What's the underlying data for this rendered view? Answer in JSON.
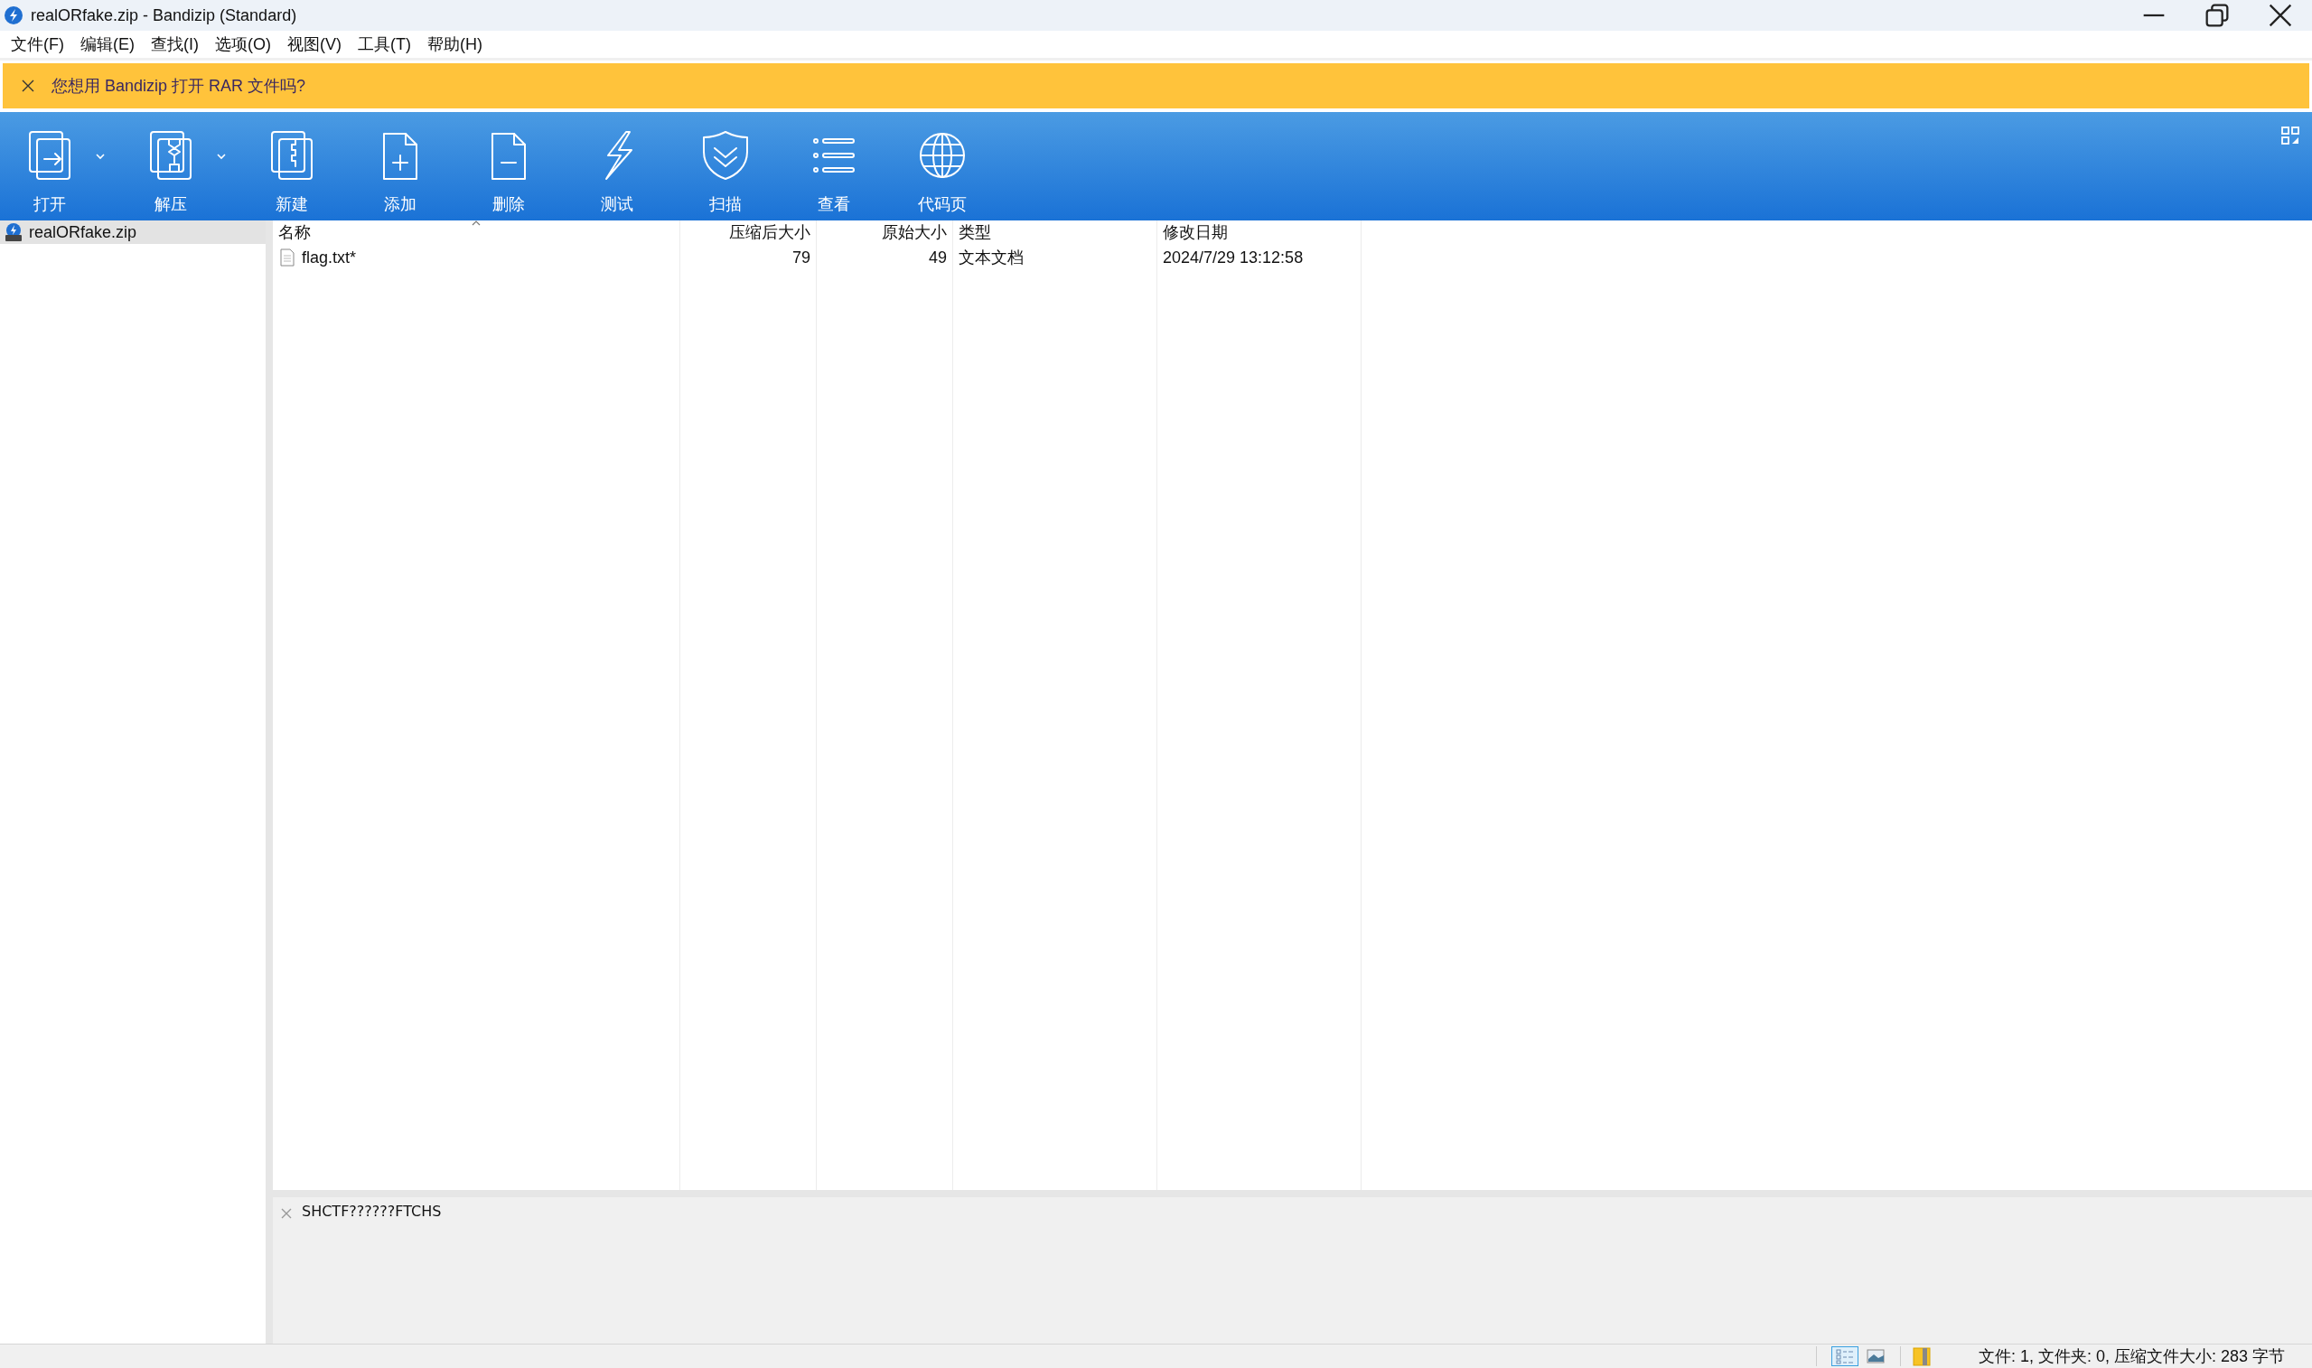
{
  "window": {
    "title": "realORfake.zip - Bandizip (Standard)"
  },
  "menu": [
    "文件(F)",
    "编辑(E)",
    "查找(I)",
    "选项(O)",
    "视图(V)",
    "工具(T)",
    "帮助(H)"
  ],
  "banner": {
    "text": "您想用 Bandizip 打开 RAR 文件吗?"
  },
  "toolbar": [
    {
      "kind": "open",
      "label": "打开",
      "dropdown": true
    },
    {
      "kind": "extract",
      "label": "解压",
      "dropdown": true
    },
    {
      "kind": "new",
      "label": "新建",
      "dropdown": false
    },
    {
      "kind": "add",
      "label": "添加",
      "dropdown": false
    },
    {
      "kind": "delete",
      "label": "删除",
      "dropdown": false
    },
    {
      "kind": "test",
      "label": "测试",
      "dropdown": false
    },
    {
      "kind": "scan",
      "label": "扫描",
      "dropdown": false
    },
    {
      "kind": "view",
      "label": "查看",
      "dropdown": false
    },
    {
      "kind": "codepage",
      "label": "代码页",
      "dropdown": false
    }
  ],
  "tree": [
    {
      "label": "realORfake.zip",
      "selected": true
    }
  ],
  "table": {
    "columns": [
      {
        "label": "名称",
        "kind": "text",
        "sorted": true
      },
      {
        "label": "压缩后大小",
        "kind": "number",
        "sorted": false
      },
      {
        "label": "原始大小",
        "kind": "number",
        "sorted": false
      },
      {
        "label": "类型",
        "kind": "text",
        "sorted": false
      },
      {
        "label": "修改日期",
        "kind": "text",
        "sorted": false
      }
    ],
    "rows": [
      {
        "cells": [
          "flag.txt*",
          "79",
          "49",
          "文本文档",
          "2024/7/29 13:12:58"
        ]
      }
    ]
  },
  "comment": {
    "text": "SHCTF??????FTCHS"
  },
  "status_bar": {
    "view_modes": [
      {
        "kind": "details",
        "selected": true
      },
      {
        "kind": "preview",
        "selected": false
      }
    ],
    "text": "文件: 1, 文件夹: 0, 压缩文件大小: 283 字节"
  }
}
